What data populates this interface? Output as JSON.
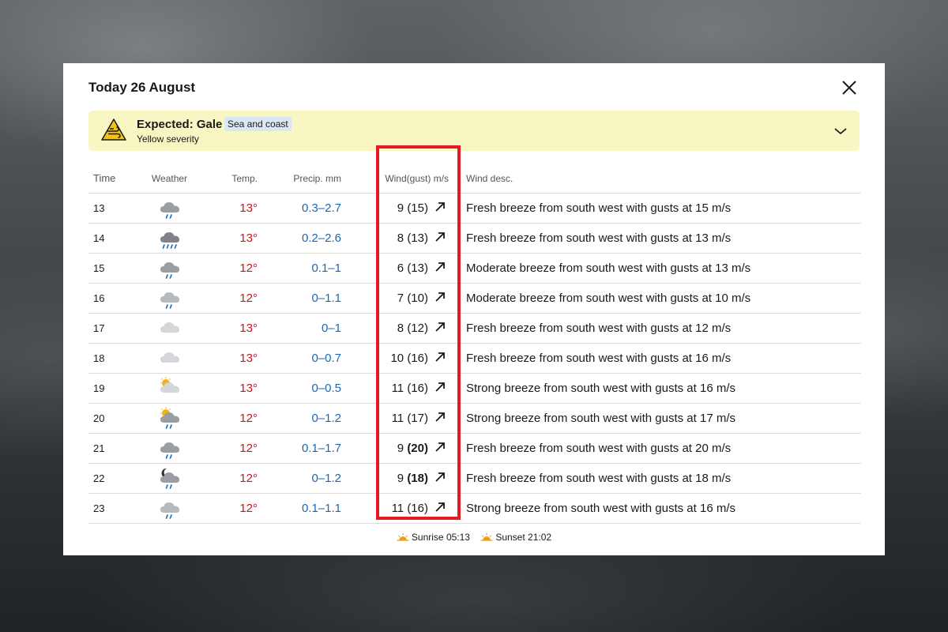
{
  "panel": {
    "title": "Today 26 August"
  },
  "alert": {
    "title": "Expected: Gale",
    "tag": "Sea and coast",
    "severity": "Yellow severity",
    "color": "#f8f6c3"
  },
  "table": {
    "headers": {
      "time": "Time",
      "weather": "Weather",
      "temp": "Temp.",
      "precip": "Precip. mm",
      "wind": "Wind(gust) m/s",
      "desc": "Wind desc."
    },
    "rows": [
      {
        "time": "13",
        "icon": "rain-cloud",
        "temp": "13°",
        "precip": "0.3–2.7",
        "wind": "9",
        "gust": "(15)",
        "gust_bold": false,
        "desc": "Fresh breeze from south west with gusts at 15 m/s"
      },
      {
        "time": "14",
        "icon": "heavy-rain-cloud",
        "temp": "13°",
        "precip": "0.2–2.6",
        "wind": "8",
        "gust": "(13)",
        "gust_bold": false,
        "desc": "Fresh breeze from south west with gusts at 13 m/s"
      },
      {
        "time": "15",
        "icon": "rain-cloud",
        "temp": "12°",
        "precip": "0.1–1",
        "wind": "6",
        "gust": "(13)",
        "gust_bold": false,
        "desc": "Moderate breeze from south west with gusts at 13 m/s"
      },
      {
        "time": "16",
        "icon": "light-rain-cloud",
        "temp": "12°",
        "precip": "0–1.1",
        "wind": "7",
        "gust": "(10)",
        "gust_bold": false,
        "desc": "Moderate breeze from south west with gusts at 10 m/s"
      },
      {
        "time": "17",
        "icon": "cloud",
        "temp": "13°",
        "precip": "0–1",
        "wind": "8",
        "gust": "(12)",
        "gust_bold": false,
        "desc": "Fresh breeze from south west with gusts at 12 m/s"
      },
      {
        "time": "18",
        "icon": "cloud",
        "temp": "13°",
        "precip": "0–0.7",
        "wind": "10",
        "gust": "(16)",
        "gust_bold": false,
        "desc": "Fresh breeze from south west with gusts at 16 m/s"
      },
      {
        "time": "19",
        "icon": "sun-cloud",
        "temp": "13°",
        "precip": "0–0.5",
        "wind": "11",
        "gust": "(16)",
        "gust_bold": false,
        "desc": "Strong breeze from south west with gusts at 16 m/s"
      },
      {
        "time": "20",
        "icon": "sun-rain-cloud",
        "temp": "12°",
        "precip": "0–1.2",
        "wind": "11",
        "gust": "(17)",
        "gust_bold": false,
        "desc": "Strong breeze from south west with gusts at 17 m/s"
      },
      {
        "time": "21",
        "icon": "rain-cloud",
        "temp": "12°",
        "precip": "0.1–1.7",
        "wind": "9",
        "gust": "(20)",
        "gust_bold": true,
        "desc": "Fresh breeze from south west with gusts at 20 m/s"
      },
      {
        "time": "22",
        "icon": "moon-rain-cloud",
        "temp": "12°",
        "precip": "0–1.2",
        "wind": "9",
        "gust": "(18)",
        "gust_bold": true,
        "desc": "Fresh breeze from south west with gusts at 18 m/s"
      },
      {
        "time": "23",
        "icon": "light-rain-cloud",
        "temp": "12°",
        "precip": "0.1–1.1",
        "wind": "11",
        "gust": "(16)",
        "gust_bold": false,
        "desc": "Strong breeze from south west with gusts at 16 m/s"
      }
    ]
  },
  "sun": {
    "sunrise": "Sunrise 05:13",
    "sunset": "Sunset 21:02"
  },
  "colors": {
    "temp": "#c8151b",
    "precip": "#1a67b8",
    "highlight": "#e41b23",
    "sun": "#e8a020"
  }
}
